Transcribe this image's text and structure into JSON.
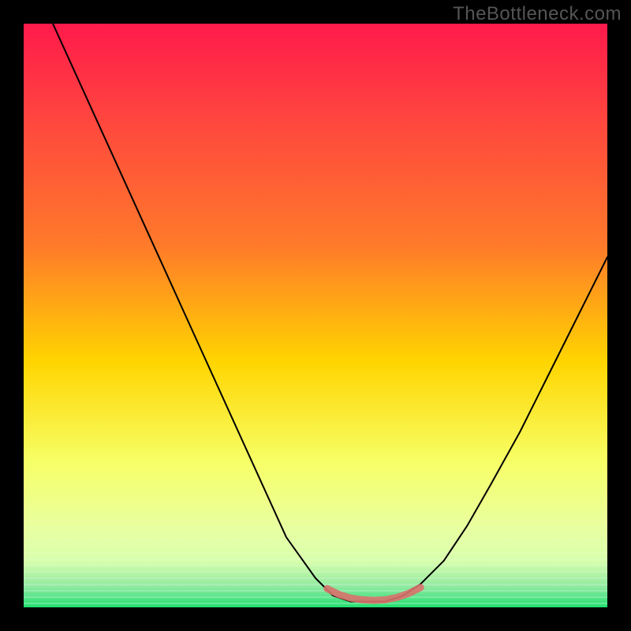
{
  "watermark": "TheBottleneck.com",
  "colors": {
    "frame": "#000000",
    "gradient_top": "#ff1a4b",
    "gradient_mid_upper": "#ff7a2a",
    "gradient_mid": "#ffd500",
    "gradient_mid_lower": "#f7ff66",
    "gradient_lower": "#d8ffad",
    "gradient_bottom": "#20e070",
    "curve": "#000000",
    "highlight": "#d9716b"
  },
  "chart_data": {
    "type": "line",
    "title": "",
    "xlabel": "",
    "ylabel": "",
    "xlim": [
      0,
      100
    ],
    "ylim": [
      0,
      100
    ],
    "grid": false,
    "legend": false,
    "series": [
      {
        "name": "bottleneck-curve",
        "x": [
          5,
          10,
          15,
          20,
          25,
          30,
          35,
          40,
          45,
          50,
          53,
          56,
          59,
          62,
          65,
          68,
          72,
          76,
          80,
          85,
          90,
          95,
          100
        ],
        "y": [
          100,
          89,
          78,
          67,
          56,
          45,
          34,
          23,
          12,
          5,
          2,
          1,
          1,
          1,
          2,
          4,
          8,
          14,
          21,
          30,
          40,
          50,
          60
        ]
      },
      {
        "name": "optimal-band",
        "x": [
          52,
          54,
          56,
          58,
          60,
          62,
          64,
          66,
          68
        ],
        "y": [
          3.2,
          2.2,
          1.6,
          1.3,
          1.2,
          1.3,
          1.7,
          2.4,
          3.4
        ]
      }
    ],
    "annotations": []
  }
}
